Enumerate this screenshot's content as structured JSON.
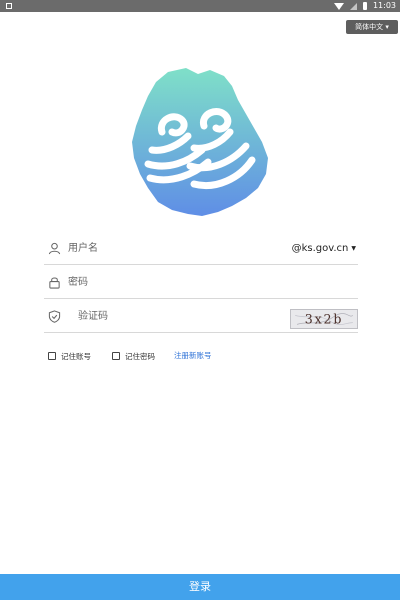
{
  "status_bar": {
    "time": "11:03",
    "icons": [
      "notification-icon",
      "wifi-icon",
      "signal-icon",
      "battery-icon"
    ]
  },
  "language": {
    "selected": "简体中文"
  },
  "form": {
    "username_placeholder": "用户名",
    "domain_selected": "@ks.gov.cn",
    "password_placeholder": "密码",
    "captcha_placeholder": "验证码",
    "captcha_text": "3x2b"
  },
  "options": {
    "remember_account": "记住账号",
    "remember_password": "记住密码",
    "register": "注册新账号"
  },
  "login_button": "登录",
  "colors": {
    "accent": "#42a2ec",
    "link": "#2a6fd6",
    "logo_top": "#7fe0c8",
    "logo_bottom": "#5f8ee6"
  }
}
